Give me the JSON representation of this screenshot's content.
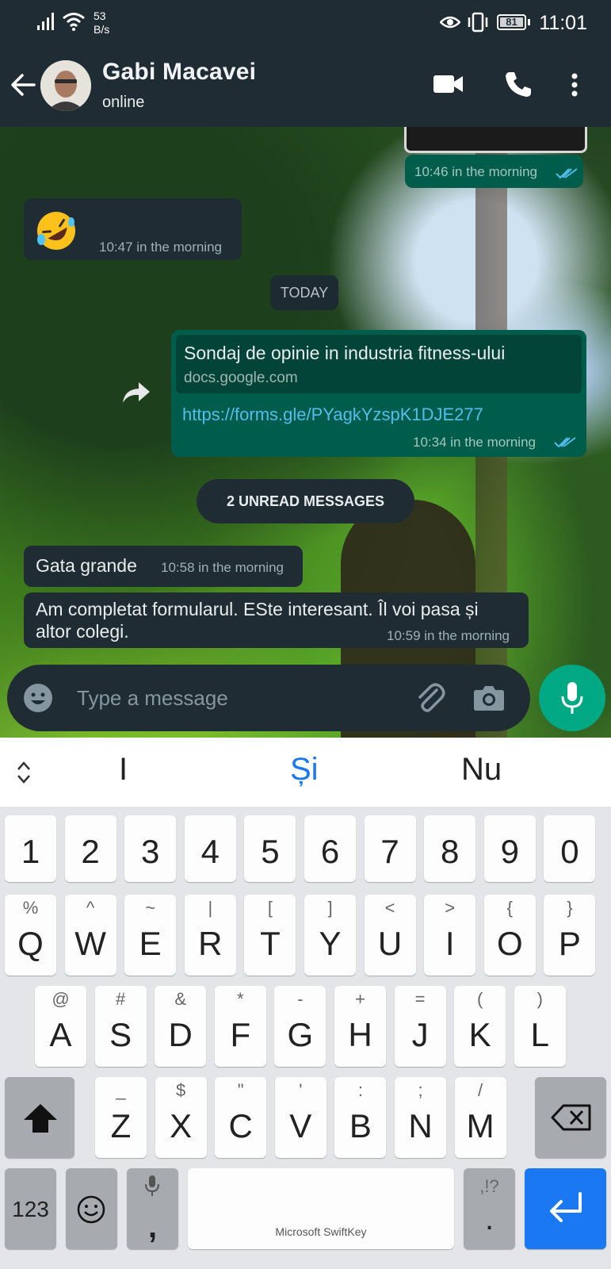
{
  "status_bar": {
    "net_speed": "53",
    "net_unit": "B/s",
    "battery": "81",
    "time": "11:01"
  },
  "header": {
    "contact_name": "Gabi Macavei",
    "contact_status": "online"
  },
  "messages": {
    "m1_time": "10:46 in the morning",
    "m2_time": "10:47 in the morning",
    "date_divider": "TODAY",
    "link_title": "Sondaj de opinie in industria fitness-ului",
    "link_domain": "docs.google.com",
    "link_url": "https://forms.gle/PYagkYzspK1DJE277",
    "link_time": "10:34 in the morning",
    "unread_divider": "2 UNREAD MESSAGES",
    "m4_text": "Gata grande",
    "m4_time": "10:58 in the morning",
    "m5_text_line1": "Am completat formularul. EStе interesant. Îl voi pasa și",
    "m5_text_line2": "altor colegi.",
    "m5_time": "10:59 in the morning"
  },
  "composer": {
    "placeholder": "Type a message"
  },
  "keyboard": {
    "suggestions": [
      "I",
      "Și",
      "Nu"
    ],
    "number_row": [
      "1",
      "2",
      "3",
      "4",
      "5",
      "6",
      "7",
      "8",
      "9",
      "0"
    ],
    "row1": [
      {
        "alt": "%",
        "main": "Q"
      },
      {
        "alt": "^",
        "main": "W"
      },
      {
        "alt": "~",
        "main": "E"
      },
      {
        "alt": "|",
        "main": "R"
      },
      {
        "alt": "[",
        "main": "T"
      },
      {
        "alt": "]",
        "main": "Y"
      },
      {
        "alt": "<",
        "main": "U"
      },
      {
        "alt": ">",
        "main": "I"
      },
      {
        "alt": "{",
        "main": "O"
      },
      {
        "alt": "}",
        "main": "P"
      }
    ],
    "row2": [
      {
        "alt": "@",
        "main": "A"
      },
      {
        "alt": "#",
        "main": "S"
      },
      {
        "alt": "&",
        "main": "D"
      },
      {
        "alt": "*",
        "main": "F"
      },
      {
        "alt": "-",
        "main": "G"
      },
      {
        "alt": "+",
        "main": "H"
      },
      {
        "alt": "=",
        "main": "J"
      },
      {
        "alt": "(",
        "main": "K"
      },
      {
        "alt": ")",
        "main": "L"
      }
    ],
    "row3": [
      {
        "alt": "_",
        "main": "Z"
      },
      {
        "alt": "$",
        "main": "X"
      },
      {
        "alt": "\"",
        "main": "C"
      },
      {
        "alt": "'",
        "main": "V"
      },
      {
        "alt": ":",
        "main": "B"
      },
      {
        "alt": ";",
        "main": "N"
      },
      {
        "alt": "/",
        "main": "M"
      }
    ],
    "numbers_key": "123",
    "comma_key": ",",
    "period_alt": ",!?",
    "period_key": ".",
    "space_brand": "Microsoft SwiftKey"
  },
  "colors": {
    "header_bg": "#1f2c34",
    "incoming_bubble": "#1f2c34",
    "outgoing_bubble": "#005c4b",
    "accent_green": "#00a884",
    "read_ticks": "#53bdeb",
    "enter_key_blue": "#1a78f2"
  }
}
